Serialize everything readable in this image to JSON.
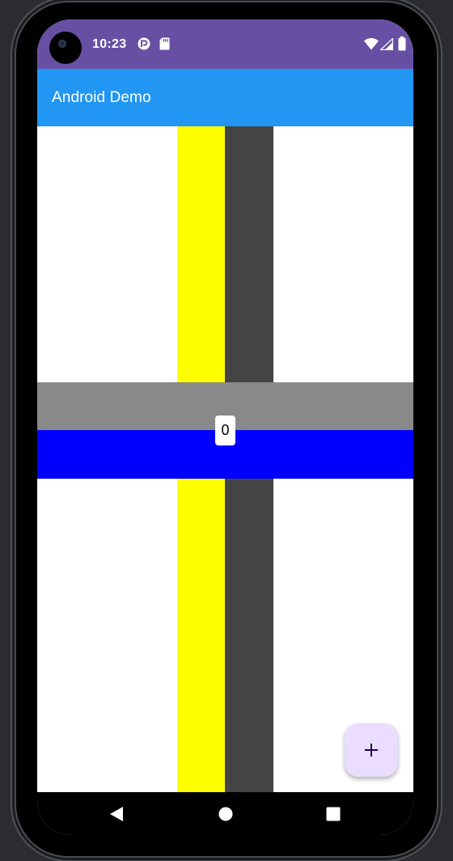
{
  "status_bar": {
    "time": "10:23",
    "left_icons": [
      "pocket-casts-icon",
      "sd-card-icon"
    ],
    "right_icons": [
      "wifi-icon",
      "cellular-signal-icon",
      "battery-icon"
    ],
    "background": "#6750a4"
  },
  "app_bar": {
    "title": "Android Demo",
    "background": "#2196f3"
  },
  "content": {
    "counter_value": "0",
    "colors": {
      "yellow_column": "#ffff00",
      "dark_column": "#444444",
      "gray_band": "#898989",
      "blue_band": "#0000ff"
    }
  },
  "fab": {
    "icon": "plus-icon",
    "background": "#eaddff"
  },
  "nav_bar": {
    "buttons": [
      "back-icon",
      "home-icon",
      "recents-icon"
    ]
  }
}
